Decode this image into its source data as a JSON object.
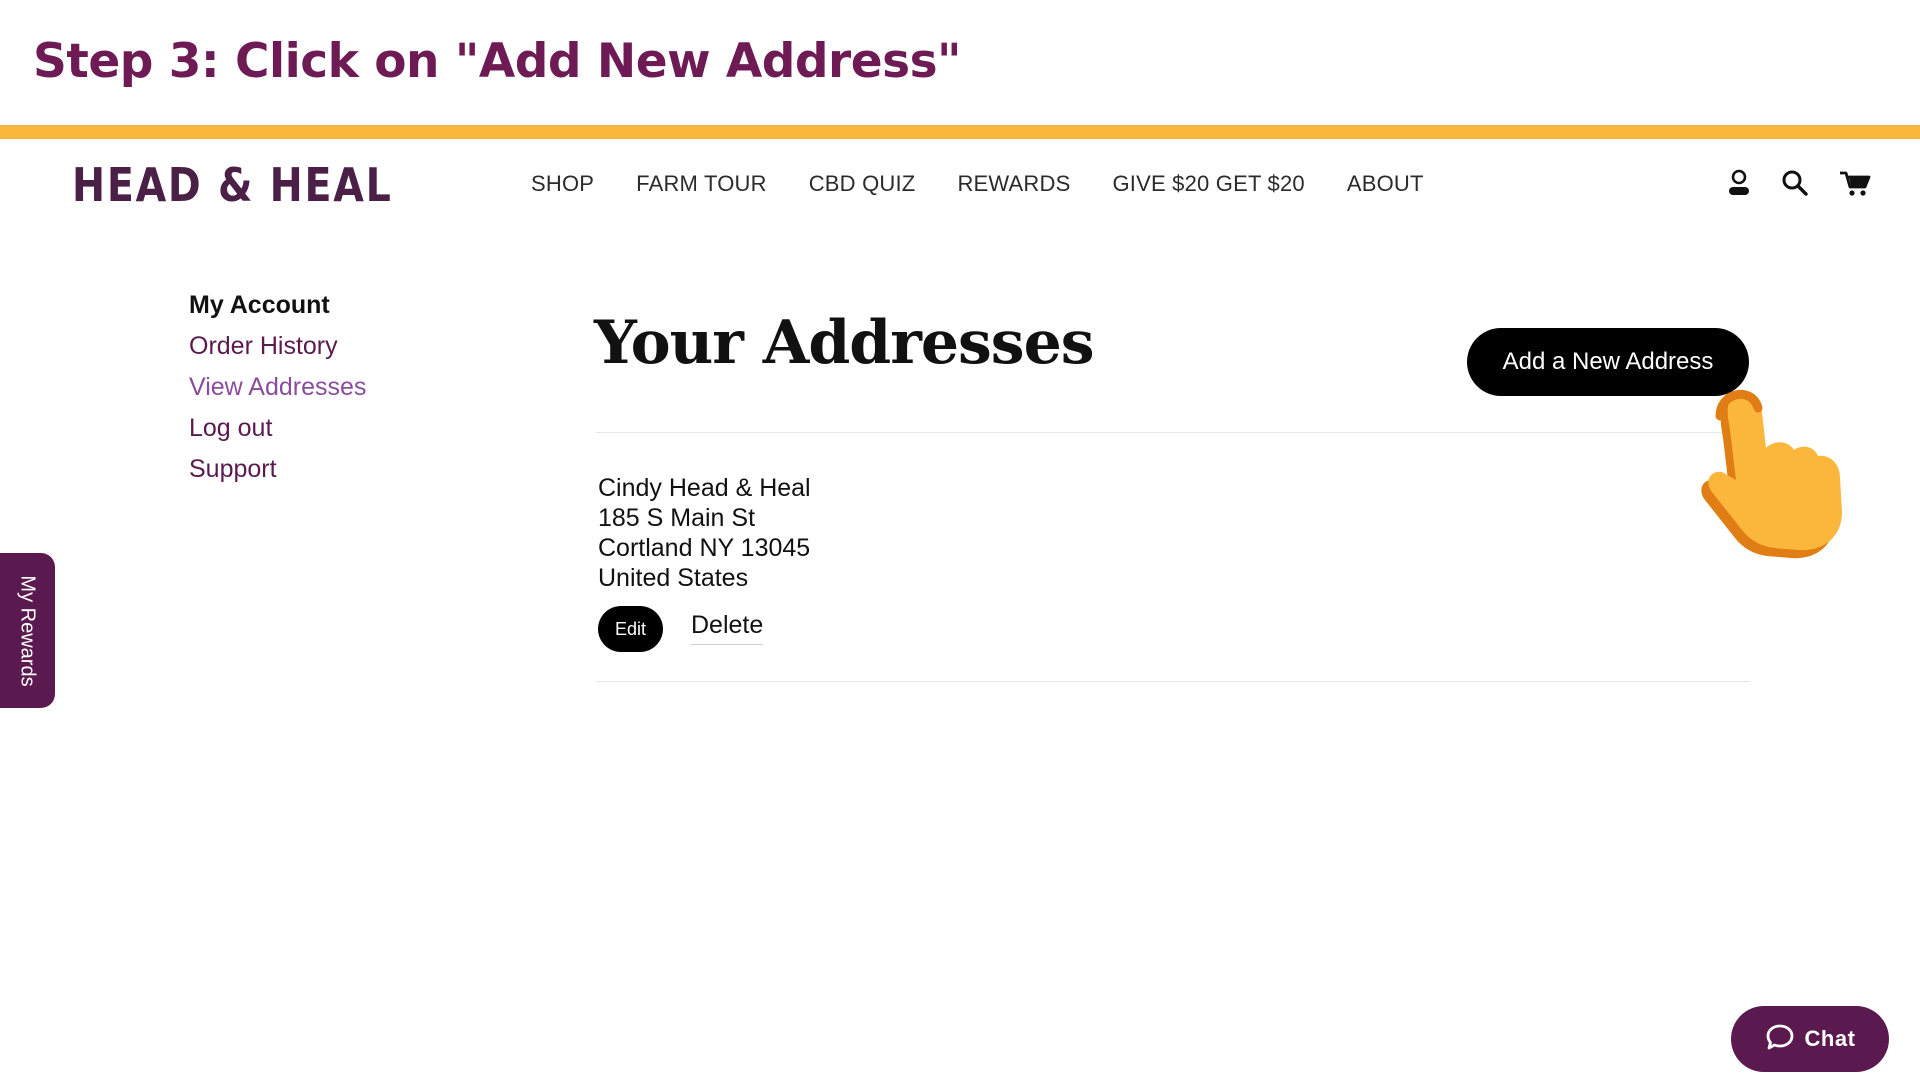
{
  "step": {
    "title": "Step 3: Click on \"Add New Address\""
  },
  "header": {
    "logo": "HEAD & HEAL",
    "nav": [
      "SHOP",
      "FARM TOUR",
      "CBD QUIZ",
      "REWARDS",
      "GIVE $20 GET $20",
      "ABOUT"
    ],
    "icons": [
      "account-icon",
      "search-icon",
      "cart-icon"
    ]
  },
  "sidebar": {
    "heading": "My Account",
    "items": [
      "Order History",
      "View Addresses",
      "Log out",
      "Support"
    ],
    "active": "View Addresses"
  },
  "main": {
    "title": "Your Addresses",
    "add_button": "Add a New Address",
    "addresses": [
      {
        "lines": [
          "Cindy Head & Heal",
          "185 S Main St",
          "Cortland NY 13045",
          "United States"
        ],
        "edit_label": "Edit",
        "delete_label": "Delete"
      }
    ]
  },
  "rewards_tab": {
    "label": "My Rewards"
  },
  "chat": {
    "label": "Chat"
  },
  "colors": {
    "brand_purple": "#5a1a4f",
    "step_title": "#6e1b55",
    "accent_bar": "#fbb73c",
    "active_link": "#8a4d9c",
    "hand_fill": "#fbb73c",
    "hand_shadow": "#e07d14"
  }
}
